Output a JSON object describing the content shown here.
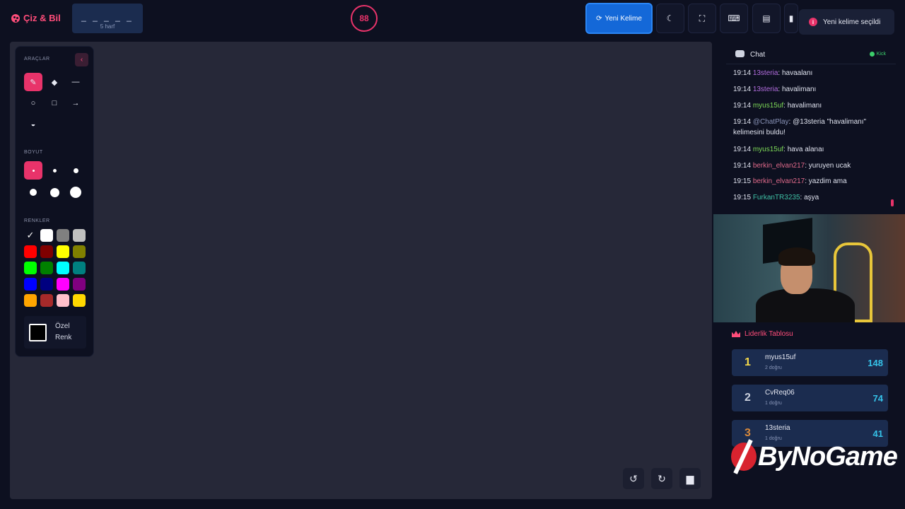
{
  "header": {
    "brand": "Çiz & Bil",
    "word_mask": "_ _ _ _ _",
    "word_length": "5 harf",
    "timer": "88",
    "new_word_label": "Yeni Kelime"
  },
  "toast": {
    "message": "Yeni kelime seçildi"
  },
  "tools_panel": {
    "tools_label": "ARAÇLAR",
    "size_label": "BOYUT",
    "colors_label": "RENKLER",
    "custom_color_line1": "Özel",
    "custom_color_line2": "Renk",
    "colors": [
      "#000000",
      "#ffffff",
      "#808080",
      "#c0c0c0",
      "#ff0000",
      "#800000",
      "#ffff00",
      "#808000",
      "#00ff00",
      "#008000",
      "#00ffff",
      "#008080",
      "#0000ff",
      "#000080",
      "#ff00ff",
      "#800080",
      "#ffa500",
      "#a52a2a",
      "#ffc0cb",
      "#ffd700"
    ]
  },
  "chat": {
    "title": "Chat",
    "platform": "Kick",
    "messages": [
      {
        "time": "19:14",
        "user": "13steria",
        "text": "havaalanı",
        "color": "#b46ee0"
      },
      {
        "time": "19:14",
        "user": "13steria",
        "text": "havalimanı",
        "color": "#b46ee0"
      },
      {
        "time": "19:14",
        "user": "myus15uf",
        "text": "havalimanı",
        "color": "#7dd957"
      },
      {
        "time": "19:14",
        "user": "@ChatPlay",
        "text": "@13steria \"havalimanı\" kelimesini buldu!",
        "color": "#8a94b8"
      },
      {
        "time": "19:14",
        "user": "myus15uf",
        "text": "hava alanaı",
        "color": "#7dd957"
      },
      {
        "time": "19:14",
        "user": "berkin_elvan217",
        "text": "yuruyen ucak",
        "color": "#e06a8a"
      },
      {
        "time": "19:15",
        "user": "berkin_elvan217",
        "text": "yazdim ama",
        "color": "#e06a8a"
      },
      {
        "time": "19:15",
        "user": "FurkanTR3235",
        "text": "aşya",
        "color": "#3fc0a5"
      }
    ]
  },
  "leaderboard": {
    "title": "Liderlik Tablosu",
    "entries": [
      {
        "rank": "1",
        "name": "myus15uf",
        "sub": "2 doğru",
        "score": "148",
        "rank_color": "#f5d94a"
      },
      {
        "rank": "2",
        "name": "CvReq06",
        "sub": "1 doğru",
        "score": "74",
        "rank_color": "#c9cfdc"
      },
      {
        "rank": "3",
        "name": "13steria",
        "sub": "1 doğru",
        "score": "41",
        "rank_color": "#d9893a"
      }
    ]
  },
  "watermark": {
    "text": "ByNoGame"
  },
  "colors": {
    "accent": "#e8336a",
    "primary_button": "#1468d8",
    "canvas": "#262838",
    "panel": "#0d1020"
  }
}
